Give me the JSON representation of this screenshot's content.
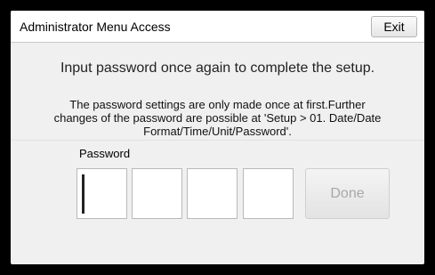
{
  "header": {
    "title": "Administrator Menu Access",
    "exit_label": "Exit"
  },
  "main": {
    "instruction": "Input password once again to complete the setup.",
    "note": "The password settings are only made once at first.Further changes of the password are possible at 'Setup > 01. Date/Date Format/Time/Unit/Password'.",
    "password_label": "Password",
    "password_digits": [
      "",
      "",
      "",
      ""
    ],
    "done_label": "Done",
    "done_enabled": false
  }
}
